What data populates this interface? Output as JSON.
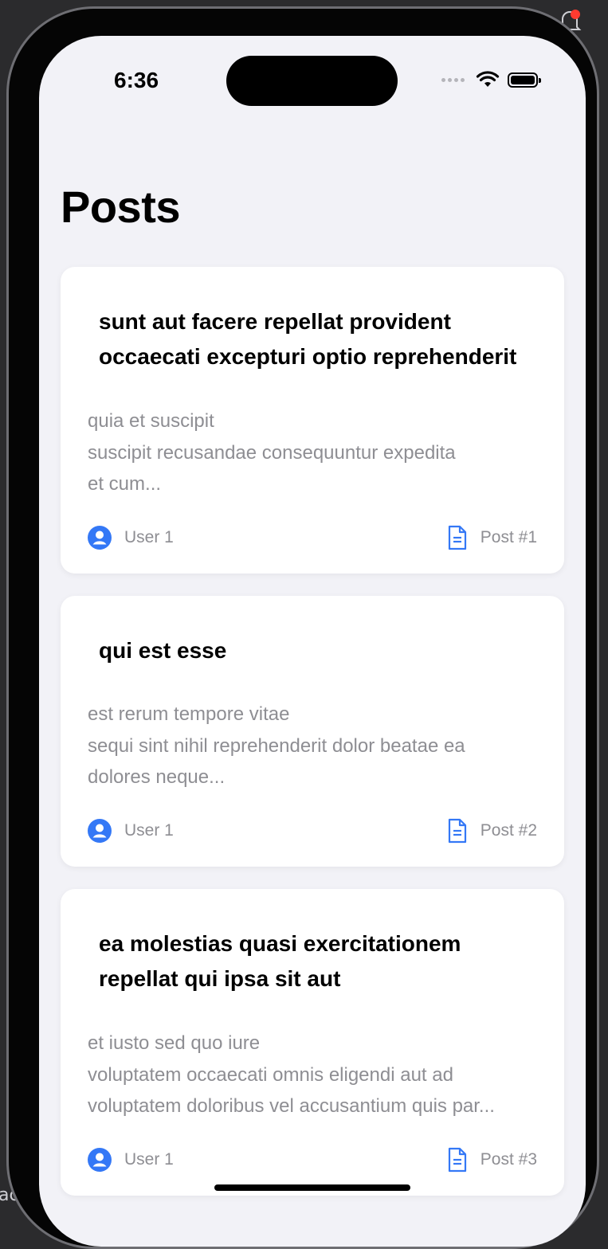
{
  "status_bar": {
    "time": "6:36"
  },
  "page": {
    "title": "Posts"
  },
  "posts": [
    {
      "title": "sunt aut facere repellat provident occaecati excepturi optio reprehenderit",
      "body": "quia et suscipit\nsuscipit recusandae consequuntur expedita\net cum...",
      "author": "User 1",
      "post_number": "Post #1"
    },
    {
      "title": "qui est esse",
      "body": "est rerum tempore vitae\nsequi sint nihil reprehenderit dolor beatae ea\ndolores neque...",
      "author": "User 1",
      "post_number": "Post #2"
    },
    {
      "title": "ea molestias quasi exercitationem repellat qui ipsa sit aut",
      "body": "et iusto sed quo iure\nvoluptatem occaecati omnis eligendi aut ad\nvoluptatem doloribus vel accusantium quis par...",
      "author": "User 1",
      "post_number": "Post #3"
    }
  ],
  "background": {
    "left_text": "aces"
  },
  "colors": {
    "accent": "#3478f6",
    "secondary_text": "#8e8e93",
    "background": "#f2f2f7"
  },
  "icons": {
    "author": "user-circle-icon",
    "post": "document-icon"
  }
}
